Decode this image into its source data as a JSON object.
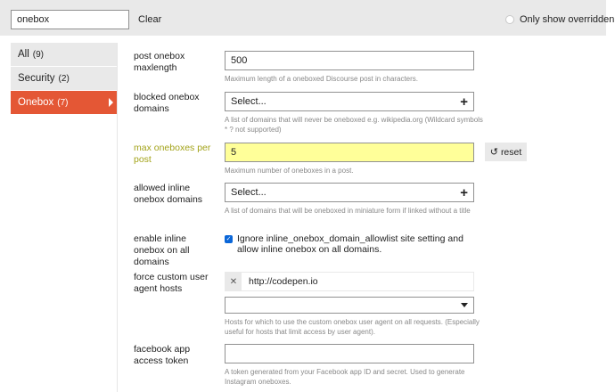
{
  "filter": {
    "search_value": "onebox",
    "clear_label": "Clear",
    "only_overridden_label": "Only show overridden"
  },
  "sidebar": {
    "items": [
      {
        "label": "All",
        "count": "(9)"
      },
      {
        "label": "Security",
        "count": "(2)"
      },
      {
        "label": "Onebox",
        "count": "(7)"
      }
    ]
  },
  "settings": {
    "maxlength": {
      "label": "post onebox maxlength",
      "value": "500",
      "desc": "Maximum length of a oneboxed Discourse post in characters."
    },
    "blocked": {
      "label": "blocked onebox domains",
      "value": "Select...",
      "desc": "A list of domains that will never be oneboxed e.g. wikipedia.org (Wildcard symbols * ? not supported)"
    },
    "max_per_post": {
      "label": "max oneboxes per post",
      "value": "5",
      "desc": "Maximum number of oneboxes in a post.",
      "reset_label": "reset"
    },
    "allowed_inline": {
      "label": "allowed inline onebox domains",
      "value": "Select...",
      "desc": "A list of domains that will be oneboxed in miniature form if linked without a title"
    },
    "enable_inline": {
      "label": "enable inline onebox on all domains",
      "checkbox_text": "Ignore inline_onebox_domain_allowlist site setting and allow inline onebox on all domains."
    },
    "force_agent": {
      "label": "force custom user agent hosts",
      "items": [
        "http://codepen.io"
      ],
      "desc": "Hosts for which to use the custom onebox user agent on all requests. (Especially useful for hosts that limit access by user agent)."
    },
    "facebook": {
      "label": "facebook app access token",
      "value": "",
      "desc": "A token generated from your Facebook app ID and secret. Used to generate Instagram oneboxes."
    }
  },
  "colors": {
    "accent": "#e45735",
    "changed_label": "#a3a31a",
    "changed_input": "#ffff99"
  }
}
